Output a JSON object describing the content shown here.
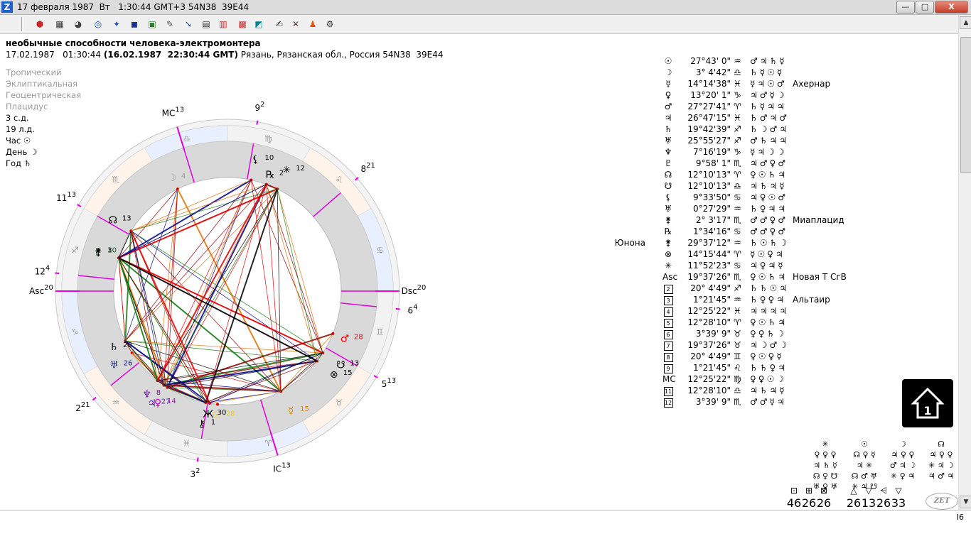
{
  "window": {
    "title": "17 февраля 1987  Вт   1:30:44 GMT+3 54N38  39E44",
    "app_icon_letter": "Z",
    "minimize": "—",
    "restore": "□",
    "close": "X"
  },
  "toolbar": {
    "buttons": [
      {
        "name": "stop-icon",
        "glyph": "⬢",
        "color": "#c62828"
      },
      {
        "name": "grid-table-icon",
        "glyph": "▦",
        "color": "#333"
      },
      {
        "name": "wheel-icon",
        "glyph": "◕",
        "color": "#444"
      },
      {
        "name": "circle-chart-icon",
        "glyph": "◎",
        "color": "#1b5ab8"
      },
      {
        "name": "star-map-icon",
        "glyph": "✦",
        "color": "#1b5ab8"
      },
      {
        "name": "earth-icon",
        "glyph": "◼",
        "color": "#1a2f9a"
      },
      {
        "name": "landscape-icon",
        "glyph": "▣",
        "color": "#2e7d32"
      },
      {
        "name": "edit-icon",
        "glyph": "✎",
        "color": "#555"
      },
      {
        "name": "compass-icon",
        "glyph": "➘",
        "color": "#1b5ab8"
      },
      {
        "name": "print-icon",
        "glyph": "▤",
        "color": "#333"
      },
      {
        "name": "color-table-icon",
        "glyph": "▥",
        "color": "#c62828"
      },
      {
        "name": "calendar-icon",
        "glyph": "▩",
        "color": "#c62828"
      },
      {
        "name": "map-icon",
        "glyph": "◩",
        "color": "#00838f"
      },
      {
        "name": "notes-icon",
        "glyph": "✍",
        "color": "#333"
      },
      {
        "name": "tools-icon",
        "glyph": "✕",
        "color": "#5d4037"
      },
      {
        "name": "person-icon",
        "glyph": "♟",
        "color": "#e65100"
      },
      {
        "name": "settings-icon",
        "glyph": "⚙",
        "color": "#333"
      }
    ]
  },
  "chart": {
    "title": "необычные способности человека-электромонтера",
    "date_local": "17.02.1987   01:30:44",
    "date_gmt": "(16.02.1987  22:30:44 GMT)",
    "place": "Рязань, Рязанская обл., Россия 54N38  39E44",
    "settings": [
      "Тропический",
      "Эклиптикальная",
      "Геоцентрическая",
      "Плацидус"
    ],
    "info": [
      "3 с.д.",
      "19 л.д.",
      "Час ☉",
      "День ☽",
      "Год ♄"
    ]
  },
  "wheel": {
    "cusps": [
      {
        "label": "Asc",
        "deg": "20"
      },
      {
        "label": "2",
        "deg": "21"
      },
      {
        "label": "3",
        "deg": "2"
      },
      {
        "label": "IC",
        "deg": "13"
      },
      {
        "label": "5",
        "deg": "13"
      },
      {
        "label": "6",
        "deg": "4"
      },
      {
        "label": "Dsc",
        "deg": "20"
      },
      {
        "label": "8",
        "deg": "21"
      },
      {
        "label": "9",
        "deg": "2"
      },
      {
        "label": "MC",
        "deg": "13"
      },
      {
        "label": "11",
        "deg": "13"
      },
      {
        "label": "12",
        "deg": "4"
      }
    ],
    "zodiac": [
      "♑",
      "♐",
      "♏",
      "♎",
      "♍",
      "♌",
      "♋",
      "♊",
      "♉",
      "♈",
      "♓",
      "♒"
    ],
    "planets": [
      {
        "glyph": "☉",
        "deg": "28",
        "color": "#e6d200"
      },
      {
        "glyph": "☿",
        "deg": "15",
        "color": "#e08a00"
      },
      {
        "glyph": "♀",
        "deg": "14",
        "color": "#c000c0"
      },
      {
        "glyph": "♂",
        "deg": "28",
        "color": "#e00000"
      },
      {
        "glyph": "♃",
        "deg": "27",
        "color": "#5a2db0"
      },
      {
        "glyph": "♄",
        "deg": "20",
        "color": "#000000"
      },
      {
        "glyph": "♅",
        "deg": "26",
        "color": "#1a237e"
      },
      {
        "glyph": "♆",
        "deg": "8",
        "color": "#6a1b9a"
      },
      {
        "glyph": "♇",
        "deg": "10",
        "color": "#1b5e20"
      },
      {
        "glyph": "☽",
        "deg": "4",
        "color": "#9e9e9e"
      },
      {
        "glyph": "☊",
        "deg": "13",
        "color": "#000000"
      },
      {
        "glyph": "☋",
        "deg": "13",
        "color": "#000000"
      },
      {
        "glyph": "⚸",
        "deg": "10",
        "color": "#000000"
      },
      {
        "glyph": "⚷",
        "deg": "1",
        "color": "#000000"
      },
      {
        "glyph": "⚵",
        "deg": "3",
        "color": "#000000"
      },
      {
        "glyph": "Ж",
        "deg": "30",
        "color": "#000000"
      },
      {
        "glyph": "⊗",
        "deg": "15",
        "color": "#000000"
      },
      {
        "glyph": "✳",
        "deg": "12",
        "color": "#000000"
      },
      {
        "glyph": "℞",
        "deg": "2",
        "color": "#000000"
      }
    ]
  },
  "positions": [
    {
      "sym": "☉",
      "pos": "27°43' 0\"",
      "sign": "♒",
      "rulers": "♂♃♄☿",
      "star": "",
      "name": ""
    },
    {
      "sym": "☽",
      "pos": "3° 4'42\"",
      "sign": "♎",
      "rulers": "♄☿☉☿",
      "star": "",
      "name": ""
    },
    {
      "sym": "☿",
      "pos": "14°14'38\"",
      "sign": "♓",
      "rulers": "☿♃☉♂",
      "star": "Ахернар",
      "name": ""
    },
    {
      "sym": "♀",
      "pos": "13°20' 1\"",
      "sign": "♑",
      "rulers": "♃♂☿☽",
      "star": "",
      "name": ""
    },
    {
      "sym": "♂",
      "pos": "27°27'41\"",
      "sign": "♈",
      "rulers": "♄☿♃♃",
      "star": "",
      "name": ""
    },
    {
      "sym": "♃",
      "pos": "26°47'15\"",
      "sign": "♓",
      "rulers": "♄♂♃♂",
      "star": "",
      "name": ""
    },
    {
      "sym": "♄",
      "pos": "19°42'39\"",
      "sign": "♐",
      "rulers": "♄☽♂♃",
      "star": "",
      "name": ""
    },
    {
      "sym": "♅",
      "pos": "25°55'27\"",
      "sign": "♐",
      "rulers": "♂♄♃♃",
      "star": "",
      "name": ""
    },
    {
      "sym": "♆",
      "pos": "7°16'19\"",
      "sign": "♑",
      "rulers": "☿♃☽☽",
      "star": "",
      "name": ""
    },
    {
      "sym": "♇",
      "pos": "9°58' 1\"",
      "sign": "♏",
      "rulers": "♃♂♀♂",
      "star": "",
      "name": ""
    },
    {
      "sym": "☊",
      "pos": "12°10'13\"",
      "sign": "♈",
      "rulers": "♀☉♄♃",
      "star": "",
      "name": ""
    },
    {
      "sym": "☋",
      "pos": "12°10'13\"",
      "sign": "♎",
      "rulers": "♃♄♃☿",
      "star": "",
      "name": ""
    },
    {
      "sym": "⚸",
      "pos": "9°33'50\"",
      "sign": "♋",
      "rulers": "♃♀☉♂",
      "star": "",
      "name": ""
    },
    {
      "sym": "♅",
      "pos": "0°27'29\"",
      "sign": "♒",
      "rulers": "♄♀♃♃",
      "star": "",
      "name": ""
    },
    {
      "sym": "⚵",
      "pos": "2° 3'17\"",
      "sign": "♏",
      "rulers": "♂♂♀♂",
      "star": "Миаплацид",
      "name": ""
    },
    {
      "sym": "℞",
      "pos": "1°34'16\"",
      "sign": "♋",
      "rulers": "♂♂♀♂",
      "star": "",
      "name": ""
    },
    {
      "sym": "⚵",
      "pos": "29°37'12\"",
      "sign": "♒",
      "rulers": "♄☉♄☽",
      "star": "",
      "name": "Юнона"
    },
    {
      "sym": "⊗",
      "pos": "14°15'44\"",
      "sign": "♈",
      "rulers": "☿☉♀♃",
      "star": "",
      "name": ""
    },
    {
      "sym": "✳",
      "pos": "11°52'23\"",
      "sign": "♋",
      "rulers": "♃♀♃☿",
      "star": "",
      "name": ""
    },
    {
      "sym": "Asc",
      "pos": "19°37'26\"",
      "sign": "♏",
      "rulers": "♀☉♄♃",
      "star": "Новая Т СгВ",
      "name": ""
    },
    {
      "sym": "2",
      "pos": "20° 4'49\"",
      "sign": "♐",
      "rulers": "♄♄☉♃",
      "star": "",
      "name": ""
    },
    {
      "sym": "3",
      "pos": "1°21'45\"",
      "sign": "♒",
      "rulers": "♄♀♀♃",
      "star": "Альтаир",
      "name": ""
    },
    {
      "sym": "4",
      "pos": "12°25'22\"",
      "sign": "♓",
      "rulers": "♃♃♃♃",
      "star": "",
      "name": ""
    },
    {
      "sym": "5",
      "pos": "12°28'10\"",
      "sign": "♈",
      "rulers": "♀☉♄♃",
      "star": "",
      "name": ""
    },
    {
      "sym": "6",
      "pos": "3°39' 9\"",
      "sign": "♉",
      "rulers": "♀♀♄☽",
      "star": "",
      "name": ""
    },
    {
      "sym": "7",
      "pos": "19°37'26\"",
      "sign": "♉",
      "rulers": "♃☽♂☽",
      "star": "",
      "name": ""
    },
    {
      "sym": "8",
      "pos": "20° 4'49\"",
      "sign": "♊",
      "rulers": "♀☉♀☿",
      "star": "",
      "name": ""
    },
    {
      "sym": "9",
      "pos": "1°21'45\"",
      "sign": "♌",
      "rulers": "♄♄♀♃",
      "star": "",
      "name": ""
    },
    {
      "sym": "MC",
      "pos": "12°25'22\"",
      "sign": "♍",
      "rulers": "♀♀☉☽",
      "star": "",
      "name": ""
    },
    {
      "sym": "11",
      "pos": "12°28'10\"",
      "sign": "♎",
      "rulers": "♃♄♃☿",
      "star": "",
      "name": ""
    },
    {
      "sym": "12",
      "pos": "3°39' 9\"",
      "sign": "♏",
      "rulers": "♂♂☿♃",
      "star": "",
      "name": ""
    }
  ],
  "rulers_panel": [
    {
      "head": "✳",
      "rows": [
        "♀ ♀ ♀",
        "♃ ♄ ☿",
        "☊ ♀ ☋",
        "♅ ♀ ♅"
      ]
    },
    {
      "head": "☉",
      "rows": [
        "☊ ♀ ☿",
        "♃ ✳",
        "☊ ♂ ♅",
        "✳ ♃ ☋"
      ]
    },
    {
      "head": "☽",
      "rows": [
        "♃ ♀ ♀",
        "♂ ♃ ☽",
        "✳ ♀ ♃",
        ""
      ]
    },
    {
      "head": "☊",
      "rows": [
        "♃ ♀ ♀",
        "✳ ♃ ☽",
        "♃ ♂ ♃",
        ""
      ]
    }
  ],
  "aspect_stats": [
    {
      "glyph": "⊡",
      "value": "46"
    },
    {
      "glyph": "⊞",
      "value": "26"
    },
    {
      "glyph": "⊠",
      "value": "26"
    },
    {
      "glyph": "△",
      "value": "26"
    },
    {
      "glyph": "▽",
      "value": "13"
    },
    {
      "glyph": "⩤",
      "value": "26"
    },
    {
      "glyph": "▽",
      "value": "33"
    }
  ],
  "zet_logo": "ZET",
  "status_number": "I6",
  "colors": {
    "magenta_axis": "#e000e0",
    "inner_ring": "#d9d9d9",
    "outer_ring": "#ececec"
  }
}
